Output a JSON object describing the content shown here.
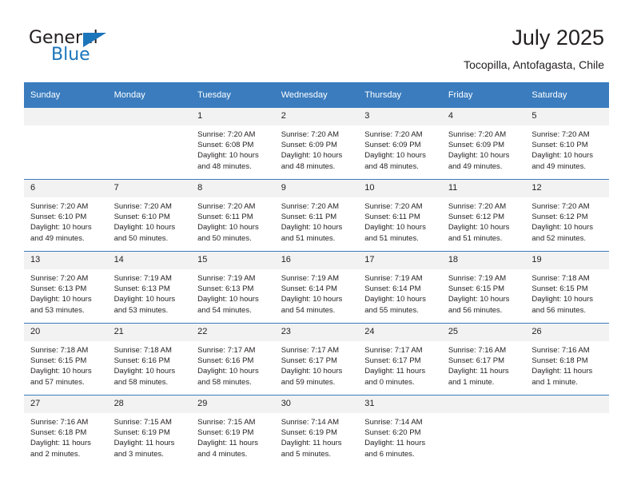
{
  "brand": {
    "line1": "General",
    "line2": "Blue",
    "triangle_color": "#1b75bb"
  },
  "header": {
    "title": "July 2025",
    "location": "Tocopilla, Antofagasta, Chile"
  },
  "theme": {
    "header_bg": "#3a7cbe",
    "daynum_bg": "#f2f2f2",
    "grid_line": "#3a7cbe",
    "text": "#231f20"
  },
  "weekday_headers": [
    "Sunday",
    "Monday",
    "Tuesday",
    "Wednesday",
    "Thursday",
    "Friday",
    "Saturday"
  ],
  "weeks": [
    [
      {
        "day": "",
        "sunrise": "",
        "sunset": "",
        "daylight1": "",
        "daylight2": "",
        "empty": true
      },
      {
        "day": "",
        "sunrise": "",
        "sunset": "",
        "daylight1": "",
        "daylight2": "",
        "empty": true
      },
      {
        "day": "1",
        "sunrise": "Sunrise: 7:20 AM",
        "sunset": "Sunset: 6:08 PM",
        "daylight1": "Daylight: 10 hours",
        "daylight2": "and 48 minutes."
      },
      {
        "day": "2",
        "sunrise": "Sunrise: 7:20 AM",
        "sunset": "Sunset: 6:09 PM",
        "daylight1": "Daylight: 10 hours",
        "daylight2": "and 48 minutes."
      },
      {
        "day": "3",
        "sunrise": "Sunrise: 7:20 AM",
        "sunset": "Sunset: 6:09 PM",
        "daylight1": "Daylight: 10 hours",
        "daylight2": "and 48 minutes."
      },
      {
        "day": "4",
        "sunrise": "Sunrise: 7:20 AM",
        "sunset": "Sunset: 6:09 PM",
        "daylight1": "Daylight: 10 hours",
        "daylight2": "and 49 minutes."
      },
      {
        "day": "5",
        "sunrise": "Sunrise: 7:20 AM",
        "sunset": "Sunset: 6:10 PM",
        "daylight1": "Daylight: 10 hours",
        "daylight2": "and 49 minutes."
      }
    ],
    [
      {
        "day": "6",
        "sunrise": "Sunrise: 7:20 AM",
        "sunset": "Sunset: 6:10 PM",
        "daylight1": "Daylight: 10 hours",
        "daylight2": "and 49 minutes."
      },
      {
        "day": "7",
        "sunrise": "Sunrise: 7:20 AM",
        "sunset": "Sunset: 6:10 PM",
        "daylight1": "Daylight: 10 hours",
        "daylight2": "and 50 minutes."
      },
      {
        "day": "8",
        "sunrise": "Sunrise: 7:20 AM",
        "sunset": "Sunset: 6:11 PM",
        "daylight1": "Daylight: 10 hours",
        "daylight2": "and 50 minutes."
      },
      {
        "day": "9",
        "sunrise": "Sunrise: 7:20 AM",
        "sunset": "Sunset: 6:11 PM",
        "daylight1": "Daylight: 10 hours",
        "daylight2": "and 51 minutes."
      },
      {
        "day": "10",
        "sunrise": "Sunrise: 7:20 AM",
        "sunset": "Sunset: 6:11 PM",
        "daylight1": "Daylight: 10 hours",
        "daylight2": "and 51 minutes."
      },
      {
        "day": "11",
        "sunrise": "Sunrise: 7:20 AM",
        "sunset": "Sunset: 6:12 PM",
        "daylight1": "Daylight: 10 hours",
        "daylight2": "and 51 minutes."
      },
      {
        "day": "12",
        "sunrise": "Sunrise: 7:20 AM",
        "sunset": "Sunset: 6:12 PM",
        "daylight1": "Daylight: 10 hours",
        "daylight2": "and 52 minutes."
      }
    ],
    [
      {
        "day": "13",
        "sunrise": "Sunrise: 7:20 AM",
        "sunset": "Sunset: 6:13 PM",
        "daylight1": "Daylight: 10 hours",
        "daylight2": "and 53 minutes."
      },
      {
        "day": "14",
        "sunrise": "Sunrise: 7:19 AM",
        "sunset": "Sunset: 6:13 PM",
        "daylight1": "Daylight: 10 hours",
        "daylight2": "and 53 minutes."
      },
      {
        "day": "15",
        "sunrise": "Sunrise: 7:19 AM",
        "sunset": "Sunset: 6:13 PM",
        "daylight1": "Daylight: 10 hours",
        "daylight2": "and 54 minutes."
      },
      {
        "day": "16",
        "sunrise": "Sunrise: 7:19 AM",
        "sunset": "Sunset: 6:14 PM",
        "daylight1": "Daylight: 10 hours",
        "daylight2": "and 54 minutes."
      },
      {
        "day": "17",
        "sunrise": "Sunrise: 7:19 AM",
        "sunset": "Sunset: 6:14 PM",
        "daylight1": "Daylight: 10 hours",
        "daylight2": "and 55 minutes."
      },
      {
        "day": "18",
        "sunrise": "Sunrise: 7:19 AM",
        "sunset": "Sunset: 6:15 PM",
        "daylight1": "Daylight: 10 hours",
        "daylight2": "and 56 minutes."
      },
      {
        "day": "19",
        "sunrise": "Sunrise: 7:18 AM",
        "sunset": "Sunset: 6:15 PM",
        "daylight1": "Daylight: 10 hours",
        "daylight2": "and 56 minutes."
      }
    ],
    [
      {
        "day": "20",
        "sunrise": "Sunrise: 7:18 AM",
        "sunset": "Sunset: 6:15 PM",
        "daylight1": "Daylight: 10 hours",
        "daylight2": "and 57 minutes."
      },
      {
        "day": "21",
        "sunrise": "Sunrise: 7:18 AM",
        "sunset": "Sunset: 6:16 PM",
        "daylight1": "Daylight: 10 hours",
        "daylight2": "and 58 minutes."
      },
      {
        "day": "22",
        "sunrise": "Sunrise: 7:17 AM",
        "sunset": "Sunset: 6:16 PM",
        "daylight1": "Daylight: 10 hours",
        "daylight2": "and 58 minutes."
      },
      {
        "day": "23",
        "sunrise": "Sunrise: 7:17 AM",
        "sunset": "Sunset: 6:17 PM",
        "daylight1": "Daylight: 10 hours",
        "daylight2": "and 59 minutes."
      },
      {
        "day": "24",
        "sunrise": "Sunrise: 7:17 AM",
        "sunset": "Sunset: 6:17 PM",
        "daylight1": "Daylight: 11 hours",
        "daylight2": "and 0 minutes."
      },
      {
        "day": "25",
        "sunrise": "Sunrise: 7:16 AM",
        "sunset": "Sunset: 6:17 PM",
        "daylight1": "Daylight: 11 hours",
        "daylight2": "and 1 minute."
      },
      {
        "day": "26",
        "sunrise": "Sunrise: 7:16 AM",
        "sunset": "Sunset: 6:18 PM",
        "daylight1": "Daylight: 11 hours",
        "daylight2": "and 1 minute."
      }
    ],
    [
      {
        "day": "27",
        "sunrise": "Sunrise: 7:16 AM",
        "sunset": "Sunset: 6:18 PM",
        "daylight1": "Daylight: 11 hours",
        "daylight2": "and 2 minutes."
      },
      {
        "day": "28",
        "sunrise": "Sunrise: 7:15 AM",
        "sunset": "Sunset: 6:19 PM",
        "daylight1": "Daylight: 11 hours",
        "daylight2": "and 3 minutes."
      },
      {
        "day": "29",
        "sunrise": "Sunrise: 7:15 AM",
        "sunset": "Sunset: 6:19 PM",
        "daylight1": "Daylight: 11 hours",
        "daylight2": "and 4 minutes."
      },
      {
        "day": "30",
        "sunrise": "Sunrise: 7:14 AM",
        "sunset": "Sunset: 6:19 PM",
        "daylight1": "Daylight: 11 hours",
        "daylight2": "and 5 minutes."
      },
      {
        "day": "31",
        "sunrise": "Sunrise: 7:14 AM",
        "sunset": "Sunset: 6:20 PM",
        "daylight1": "Daylight: 11 hours",
        "daylight2": "and 6 minutes."
      },
      {
        "day": "",
        "sunrise": "",
        "sunset": "",
        "daylight1": "",
        "daylight2": "",
        "empty": true
      },
      {
        "day": "",
        "sunrise": "",
        "sunset": "",
        "daylight1": "",
        "daylight2": "",
        "empty": true
      }
    ]
  ]
}
